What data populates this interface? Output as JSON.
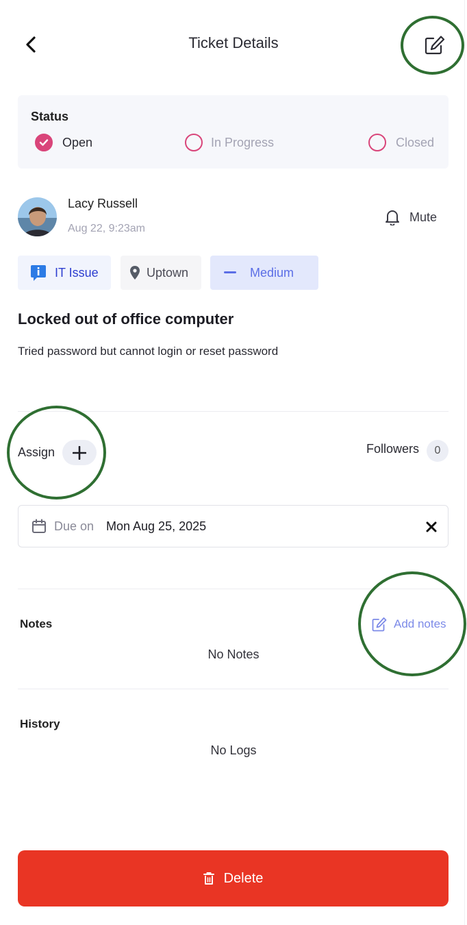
{
  "header": {
    "title": "Ticket Details",
    "back_icon": "chevron-left-icon",
    "edit_icon": "edit-icon"
  },
  "status": {
    "title": "Status",
    "options": [
      {
        "label": "Open",
        "selected": true
      },
      {
        "label": "In Progress",
        "selected": false
      },
      {
        "label": "Closed",
        "selected": false
      }
    ]
  },
  "author": {
    "name": "Lacy Russell",
    "timestamp": "Aug 22, 9:23am",
    "mute_label": "Mute"
  },
  "tags": {
    "category": "IT Issue",
    "location": "Uptown",
    "priority": "Medium"
  },
  "ticket": {
    "title": "Locked out of office computer",
    "description": "Tried password but cannot login or reset password"
  },
  "assign": {
    "label": "Assign",
    "followers_label": "Followers",
    "followers_count": "0"
  },
  "due": {
    "label": "Due on",
    "value": "Mon Aug 25, 2025"
  },
  "notes": {
    "title": "Notes",
    "add_label": "Add notes",
    "empty": "No Notes"
  },
  "history": {
    "title": "History",
    "empty": "No Logs"
  },
  "delete_label": "Delete",
  "colors": {
    "accent_pink": "#d9457a",
    "delete_red": "#e93524",
    "annotation_green": "#2f6f32",
    "link_blue": "#7c8ae8"
  }
}
